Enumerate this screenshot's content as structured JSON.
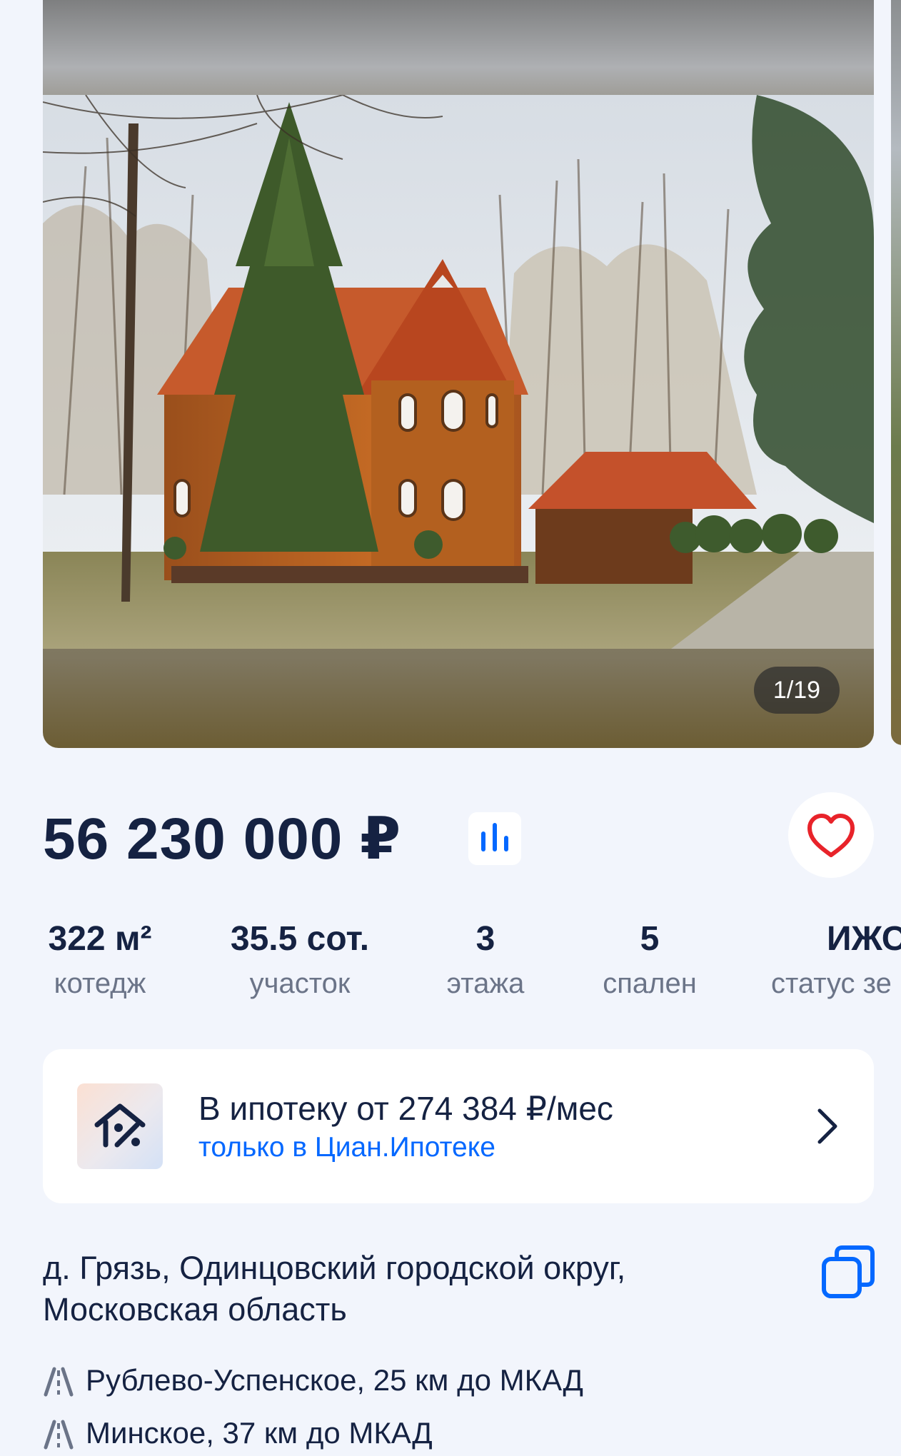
{
  "gallery": {
    "counter": "1/19"
  },
  "price": {
    "value": "56 230 000 ₽"
  },
  "specs": [
    {
      "value": "322 м²",
      "label": "котедж"
    },
    {
      "value": "35.5 сот.",
      "label": "участок"
    },
    {
      "value": "3",
      "label": "этажа"
    },
    {
      "value": "5",
      "label": "спален"
    },
    {
      "value": "ИЖС",
      "label": "статус зе"
    }
  ],
  "mortgage": {
    "title": "В ипотеку от 274 384 ₽/мес",
    "subtitle": "только в Циан.Ипотеке"
  },
  "address": {
    "line1": "д. Грязь, Одинцовский городской округ,",
    "line2": "Московская область"
  },
  "highways": [
    {
      "text": "Рублево-Успенское, 25 км до МКАД"
    },
    {
      "text": "Минское, 37 км до МКАД"
    }
  ],
  "colors": {
    "background": "#f2f5fc",
    "text": "#152242",
    "accent": "#0468ff",
    "favorite": "#e8232a"
  }
}
